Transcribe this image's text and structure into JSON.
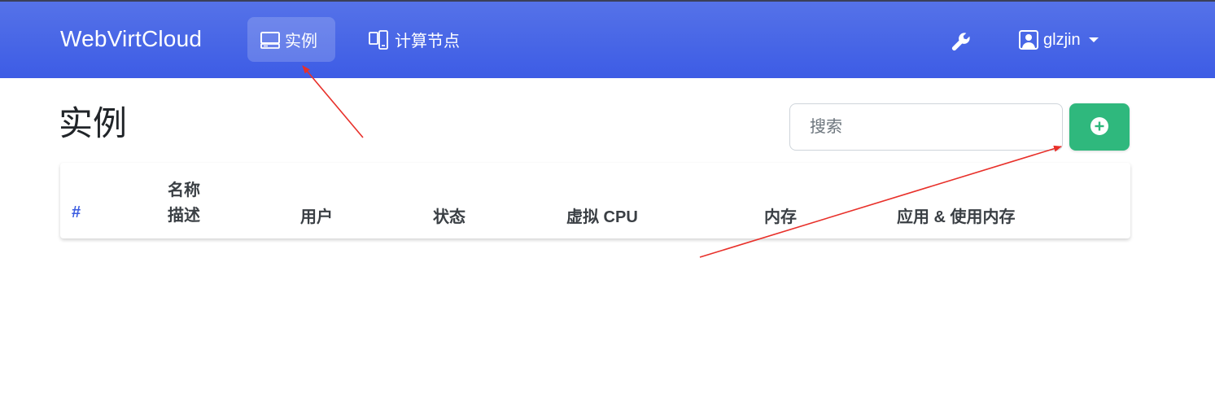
{
  "navbar": {
    "brand": "WebVirtCloud",
    "items": [
      {
        "label": "实例",
        "icon": "desktop-icon",
        "active": true
      },
      {
        "label": "计算节点",
        "icon": "servers-icon",
        "active": false
      }
    ],
    "tools_icon": "wrench-icon",
    "user": {
      "name": "glzjin",
      "icon": "user-square-icon"
    }
  },
  "page": {
    "title": "实例"
  },
  "search": {
    "placeholder": "搜索",
    "value": ""
  },
  "add_button": {
    "icon": "plus-circle-icon"
  },
  "table": {
    "headers": {
      "index": "#",
      "name": "名称",
      "description": "描述",
      "user": "用户",
      "status": "状态",
      "vcpu": "虚拟 CPU",
      "memory": "内存",
      "app_memory": "应用 & 使用内存"
    },
    "rows": []
  },
  "colors": {
    "navbar": "#4463e6",
    "add_button": "#2fb87d",
    "annotation_arrow": "#e8302a"
  }
}
